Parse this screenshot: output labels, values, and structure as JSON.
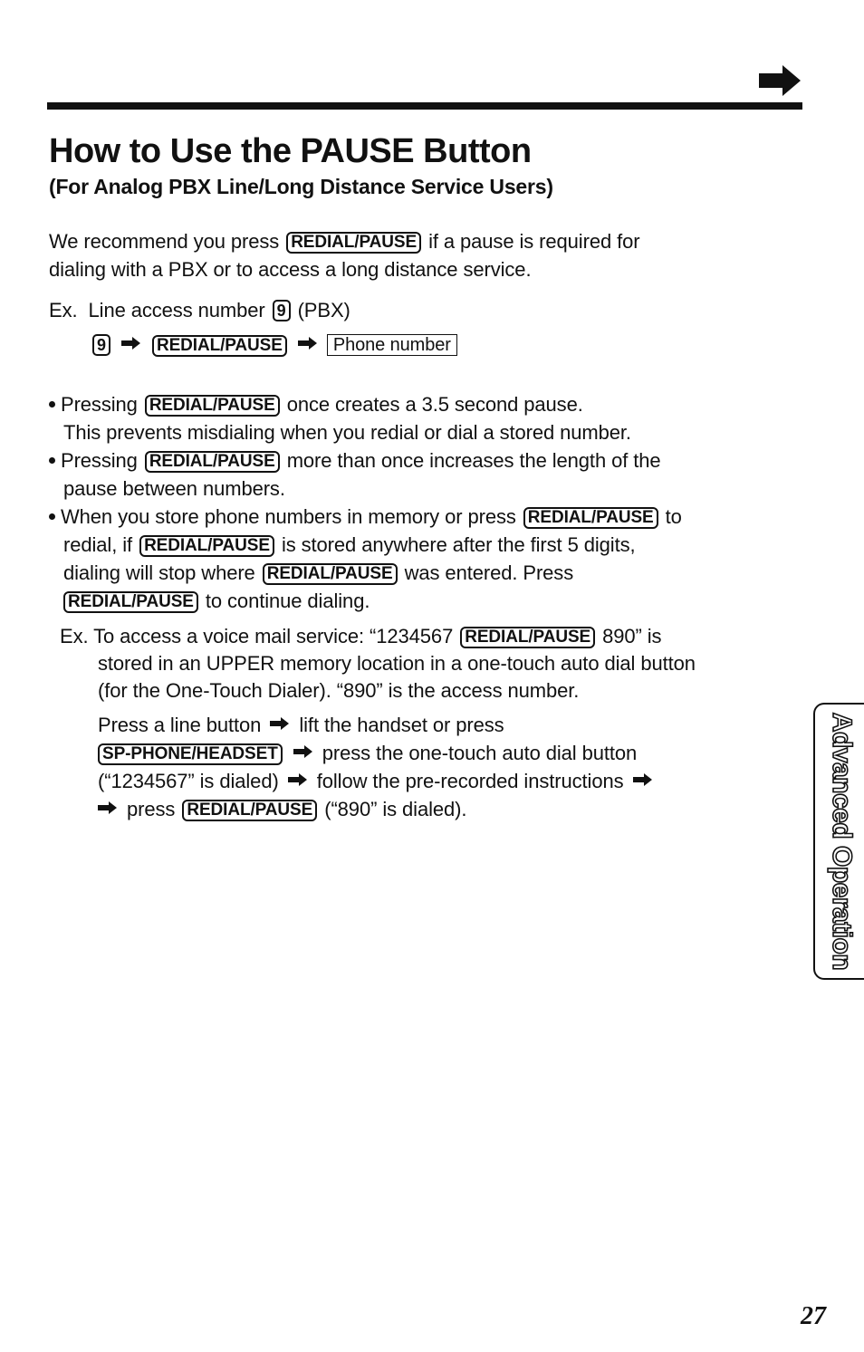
{
  "header": {
    "next_arrow_icon": "right-arrow-icon",
    "title": "How to Use the PAUSE Button",
    "subtitle": "(For Analog PBX Line/Long Distance Service Users)"
  },
  "keys": {
    "redial_pause": "REDIAL/PAUSE",
    "nine": "9",
    "sp_phone_headset": "SP-PHONE/HEADSET"
  },
  "intro": {
    "line1_before": "We recommend you press",
    "line1_after": "if a pause is required for",
    "line2": "dialing with a PBX or to access a long distance service."
  },
  "example1": {
    "line1_prefix": "Ex.",
    "line1_before": "Line access number",
    "line1_after": "(PBX)",
    "phone_number_box": "Phone number"
  },
  "bullets": [
    {
      "lines": [
        "Pressing",
        "once creates a 3.5 second pause.",
        "This prevents misdialing when you redial or dial a stored number."
      ]
    },
    {
      "lines": [
        "Pressing",
        "more than once increases the length of the",
        "pause between numbers."
      ]
    },
    {
      "lines": [
        "When you store phone numbers in memory or press",
        "to",
        "redial, if",
        "is stored anywhere after the first 5 digits,",
        "dialing will stop where",
        "was entered. Press",
        "to continue dialing."
      ]
    }
  ],
  "example2": {
    "prefix": "Ex.",
    "line1_before": "To access a voice mail service: “1234567",
    "line1_after": "890” is",
    "line2": "stored in an UPPER memory location in a one-touch auto dial button",
    "line3": "(for the One-Touch Dialer). “890” is the access number.",
    "steps": {
      "line1_a": "Press a line button",
      "line1_b": "lift the handset or press",
      "line2_b": "press the one-touch auto dial button",
      "line3_a": "(“1234567” is dialed)",
      "line3_b": "follow the pre-recorded instructions",
      "line4_a": "press",
      "line4_b": "(“890” is dialed)."
    }
  },
  "side_tab": {
    "label": "Advanced Operation"
  },
  "footer": {
    "page_number": "27"
  }
}
